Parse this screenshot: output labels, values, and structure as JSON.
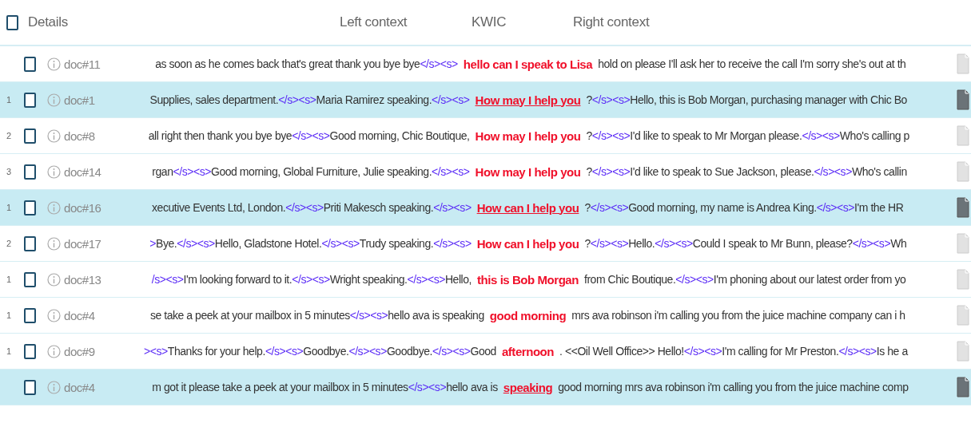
{
  "header": {
    "checked": false,
    "details": "Details",
    "left": "Left context",
    "kwic": "KWIC",
    "right": "Right context"
  },
  "rows": [
    {
      "number": "",
      "checked": false,
      "selected": false,
      "doc": "doc#11",
      "left": [
        {
          "kind": "text",
          "text": "as soon as he comes back that's great thank you bye bye"
        },
        {
          "kind": "tag",
          "text": "</s><s>"
        }
      ],
      "kwic": "hello can I speak to Lisa",
      "right": [
        {
          "kind": "text",
          "text": "hold on please I'll ask her to receive the call I'm sorry she's out at th"
        }
      ]
    },
    {
      "number": "1",
      "checked": false,
      "selected": true,
      "doc": "doc#1",
      "left": [
        {
          "kind": "text",
          "text": "Supplies, sales department."
        },
        {
          "kind": "tag",
          "text": "</s><s>"
        },
        {
          "kind": "text",
          "text": "Maria Ramirez speaking."
        },
        {
          "kind": "tag",
          "text": "</s><s>"
        }
      ],
      "kwic": "How may I help you",
      "right": [
        {
          "kind": "text",
          "text": "?"
        },
        {
          "kind": "tag",
          "text": "</s><s>"
        },
        {
          "kind": "text",
          "text": "Hello, this is Bob Morgan, purchasing manager with Chic Bo"
        }
      ]
    },
    {
      "number": "2",
      "checked": false,
      "selected": false,
      "doc": "doc#8",
      "left": [
        {
          "kind": "text",
          "text": "all right then thank you bye bye"
        },
        {
          "kind": "tag",
          "text": "</s><s>"
        },
        {
          "kind": "text",
          "text": "Good morning, Chic Boutique,"
        }
      ],
      "kwic": "How may I help you",
      "right": [
        {
          "kind": "text",
          "text": "?"
        },
        {
          "kind": "tag",
          "text": "</s><s>"
        },
        {
          "kind": "text",
          "text": "I'd like to speak to Mr Morgan please."
        },
        {
          "kind": "tag",
          "text": "</s><s>"
        },
        {
          "kind": "text",
          "text": "Who's calling p"
        }
      ]
    },
    {
      "number": "3",
      "checked": false,
      "selected": false,
      "doc": "doc#14",
      "left": [
        {
          "kind": "text",
          "text": "rgan"
        },
        {
          "kind": "tag",
          "text": "</s><s>"
        },
        {
          "kind": "text",
          "text": "Good morning, Global Furniture, Julie speaking."
        },
        {
          "kind": "tag",
          "text": "</s><s>"
        }
      ],
      "kwic": "How may I help you",
      "right": [
        {
          "kind": "text",
          "text": "?"
        },
        {
          "kind": "tag",
          "text": "</s><s>"
        },
        {
          "kind": "text",
          "text": "I'd like to speak to Sue Jackson, please."
        },
        {
          "kind": "tag",
          "text": "</s><s>"
        },
        {
          "kind": "text",
          "text": "Who's callin"
        }
      ]
    },
    {
      "number": "1",
      "checked": false,
      "selected": true,
      "doc": "doc#16",
      "left": [
        {
          "kind": "text",
          "text": "xecutive Events Ltd, London."
        },
        {
          "kind": "tag",
          "text": "</s><s>"
        },
        {
          "kind": "text",
          "text": "Priti Makesch speaking."
        },
        {
          "kind": "tag",
          "text": "</s><s>"
        }
      ],
      "kwic": "How can I help you",
      "right": [
        {
          "kind": "text",
          "text": "?"
        },
        {
          "kind": "tag",
          "text": "</s><s>"
        },
        {
          "kind": "text",
          "text": "Good morning, my name is Andrea King."
        },
        {
          "kind": "tag",
          "text": "</s><s>"
        },
        {
          "kind": "text",
          "text": "I'm the HR"
        }
      ]
    },
    {
      "number": "2",
      "checked": false,
      "selected": false,
      "doc": "doc#17",
      "left": [
        {
          "kind": "tag",
          "text": ">"
        },
        {
          "kind": "text",
          "text": "Bye."
        },
        {
          "kind": "tag",
          "text": "</s><s>"
        },
        {
          "kind": "text",
          "text": "Hello, Gladstone Hotel."
        },
        {
          "kind": "tag",
          "text": "</s><s>"
        },
        {
          "kind": "text",
          "text": "Trudy speaking."
        },
        {
          "kind": "tag",
          "text": "</s><s>"
        }
      ],
      "kwic": "How can I help you",
      "right": [
        {
          "kind": "text",
          "text": "?"
        },
        {
          "kind": "tag",
          "text": "</s><s>"
        },
        {
          "kind": "text",
          "text": "Hello."
        },
        {
          "kind": "tag",
          "text": "</s><s>"
        },
        {
          "kind": "text",
          "text": "Could I speak to Mr Bunn, please?"
        },
        {
          "kind": "tag",
          "text": "</s><s>"
        },
        {
          "kind": "text",
          "text": "Wh"
        }
      ]
    },
    {
      "number": "1",
      "checked": false,
      "selected": false,
      "doc": "doc#13",
      "left": [
        {
          "kind": "tag",
          "text": "/s><s>"
        },
        {
          "kind": "text",
          "text": "I'm looking forward to it."
        },
        {
          "kind": "tag",
          "text": "</s><s>"
        },
        {
          "kind": "text",
          "text": "Wright speaking."
        },
        {
          "kind": "tag",
          "text": "</s><s>"
        },
        {
          "kind": "text",
          "text": "Hello,"
        }
      ],
      "kwic": "this is Bob Morgan",
      "right": [
        {
          "kind": "text",
          "text": "from Chic Boutique."
        },
        {
          "kind": "tag",
          "text": "</s><s>"
        },
        {
          "kind": "text",
          "text": "I'm phoning about our latest order from yo"
        }
      ]
    },
    {
      "number": "1",
      "checked": false,
      "selected": false,
      "doc": "doc#4",
      "left": [
        {
          "kind": "text",
          "text": "se take a peek at your mailbox in 5 minutes"
        },
        {
          "kind": "tag",
          "text": "</s><s>"
        },
        {
          "kind": "text",
          "text": "hello ava is speaking"
        }
      ],
      "kwic": "good morning",
      "right": [
        {
          "kind": "text",
          "text": "mrs ava robinson i'm calling you from the juice machine company can i h"
        }
      ]
    },
    {
      "number": "1",
      "checked": false,
      "selected": false,
      "doc": "doc#9",
      "left": [
        {
          "kind": "tag",
          "text": "><s>"
        },
        {
          "kind": "text",
          "text": "Thanks for your help."
        },
        {
          "kind": "tag",
          "text": "</s><s>"
        },
        {
          "kind": "text",
          "text": "Goodbye."
        },
        {
          "kind": "tag",
          "text": "</s><s>"
        },
        {
          "kind": "text",
          "text": "Goodbye."
        },
        {
          "kind": "tag",
          "text": "</s><s>"
        },
        {
          "kind": "text",
          "text": "Good"
        }
      ],
      "kwic": "afternoon",
      "right": [
        {
          "kind": "text",
          "text": ". <<Oil Well Office>> Hello!"
        },
        {
          "kind": "tag",
          "text": "</s><s>"
        },
        {
          "kind": "text",
          "text": "I'm calling for Mr Preston."
        },
        {
          "kind": "tag",
          "text": "</s><s>"
        },
        {
          "kind": "text",
          "text": "Is he a"
        }
      ]
    },
    {
      "number": "",
      "checked": false,
      "selected": true,
      "doc": "doc#4",
      "left": [
        {
          "kind": "text",
          "text": "m got it please take a peek at your mailbox in 5 minutes"
        },
        {
          "kind": "tag",
          "text": "</s><s>"
        },
        {
          "kind": "text",
          "text": "hello ava is"
        }
      ],
      "kwic": "speaking",
      "right": [
        {
          "kind": "text",
          "text": "good morning mrs ava robinson i'm calling you from the juice machine comp"
        }
      ]
    }
  ]
}
